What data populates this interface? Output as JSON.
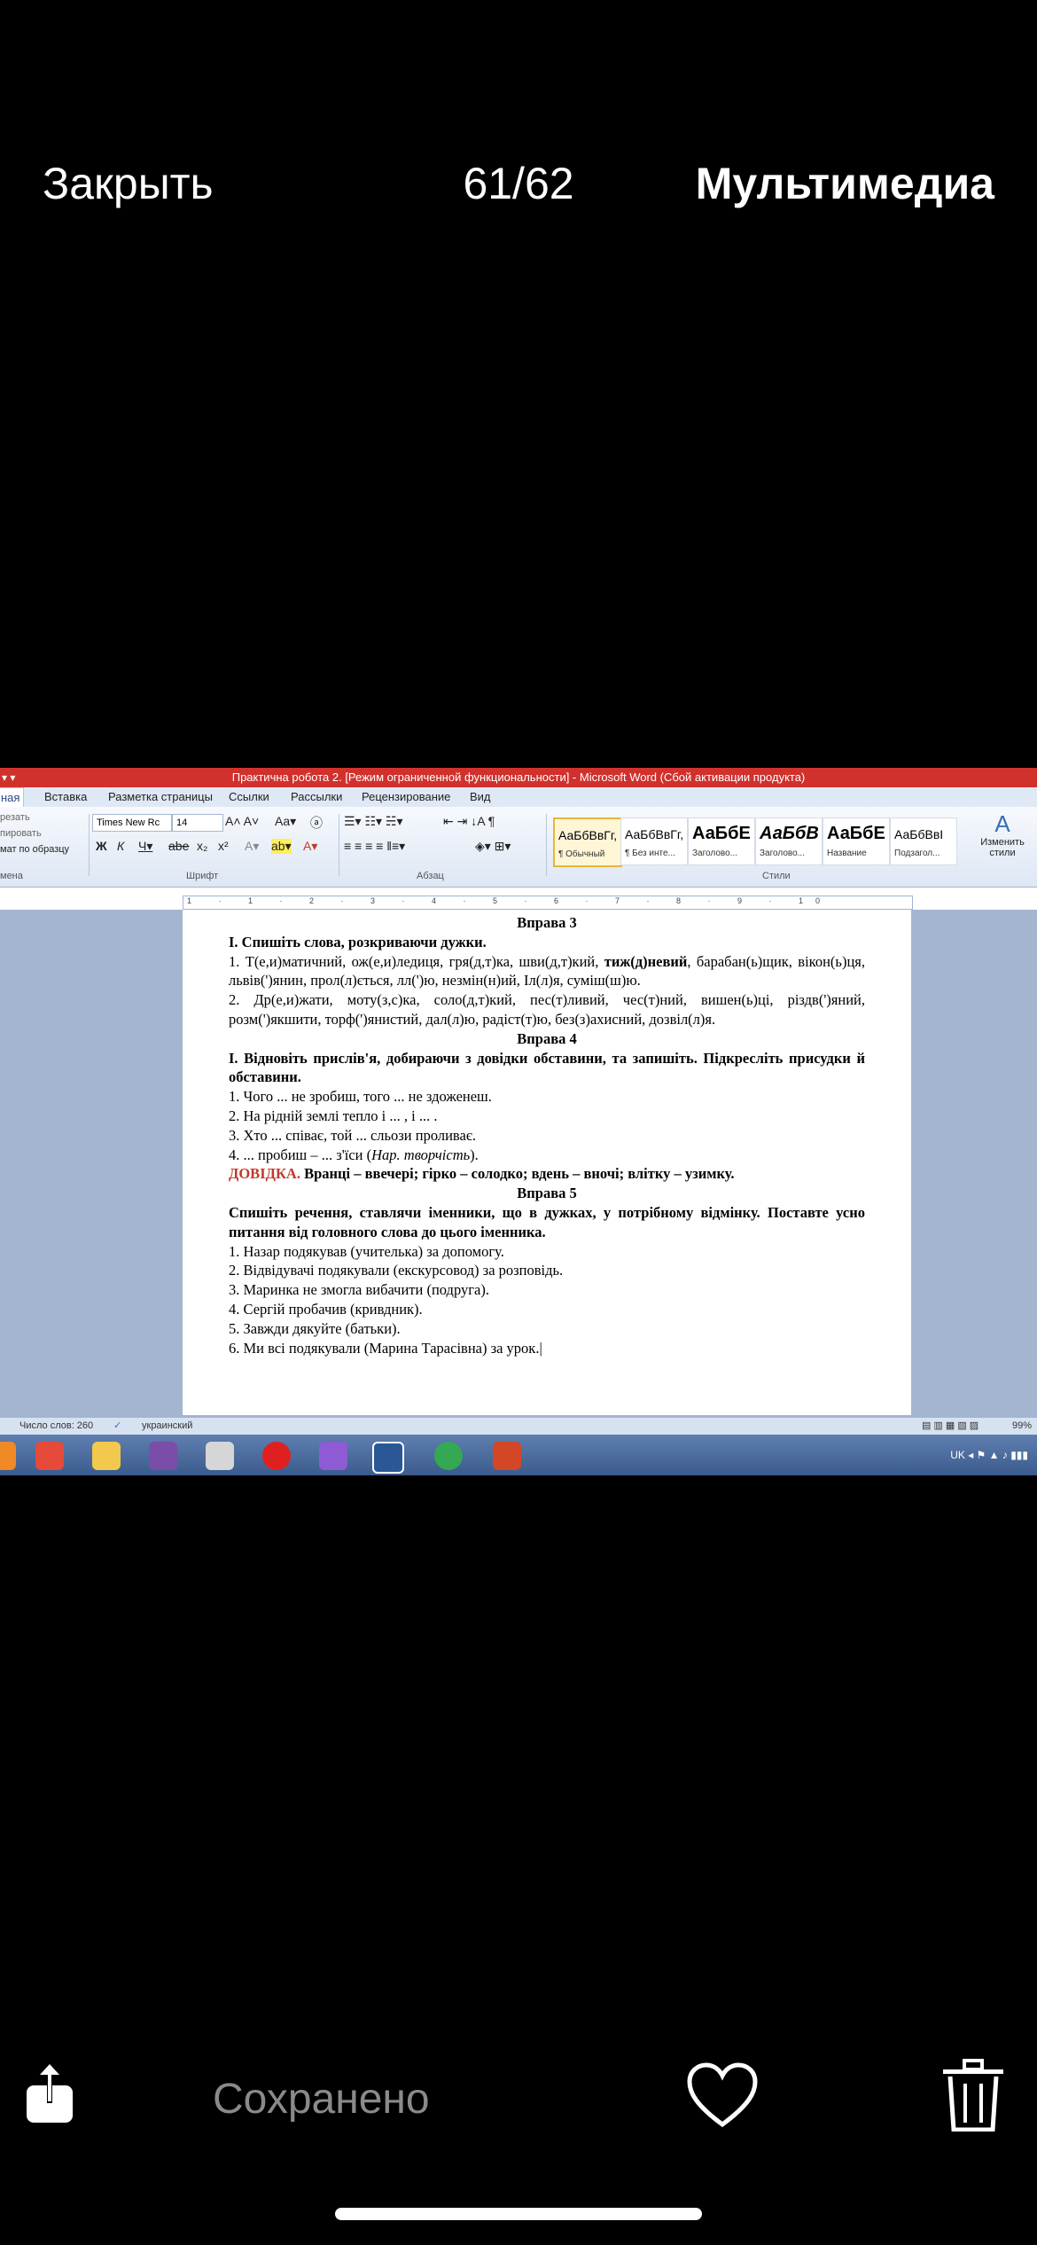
{
  "viewer": {
    "close_label": "Закрыть",
    "counter": "61/62",
    "media_label": "Мультимедиа",
    "saved_label": "Сохранено",
    "share_icon": "share-icon",
    "heart_icon": "heart-icon",
    "trash_icon": "trash-icon"
  },
  "word": {
    "title": "Практична робота 2. [Режим ограниченной функциональности] - Microsoft Word (Сбой активации продукта)",
    "tabs": [
      "ная",
      "Вставка",
      "Разметка страницы",
      "Ссылки",
      "Рассылки",
      "Рецензирование",
      "Вид"
    ],
    "clipboard": {
      "cut": "резать",
      "copy": "пировать",
      "format": "мат по образцу",
      "label": "мена"
    },
    "font": {
      "name": "Times New Rc",
      "size": "14",
      "label": "Шрифт"
    },
    "paragraph_label": "Абзац",
    "styles_label": "Стили",
    "styles": [
      {
        "sample": "АаБбВвГг,",
        "name": "¶ Обычный"
      },
      {
        "sample": "АаБбВвГг,",
        "name": "¶ Без инте..."
      },
      {
        "sample": "АаБбЕ",
        "name": "Заголово..."
      },
      {
        "sample": "АаБбВ",
        "name": "Заголово..."
      },
      {
        "sample": "АаБбЕ",
        "name": "Название"
      },
      {
        "sample": "АаБбВвI",
        "name": "Подзагол..."
      }
    ],
    "change_styles": "Изменить стили",
    "status": {
      "words": "Число слов: 260",
      "lang": "украинский",
      "zoom": "99%"
    },
    "tray_lang": "UK"
  },
  "document": {
    "v3_title": "Вправа 3",
    "v3_task": "I. Спишіть слова, розкриваючи дужки.",
    "v3_p1_a": "1. Т(е,и)матичний, ож(е,и)ледиця, гря(д,т)ка, шви(д,т)кий, ",
    "v3_p1_bold": "тиж(д)невий",
    "v3_p1_b": ", барабан(ь)щик, вікон(ь)ця, львів(')янин, прол(л)ється, лл(')ю, незмін(н)ий, Іл(л)я, суміш(ш)ю.",
    "v3_p2": "2. Др(е,и)жати, моту(з,с)ка, соло(д,т)кий, пес(т)ливий, чес(т)ний, вишен(ь)ці, різдв(')яний, розм(')якшити, торф(')янистий, дал(л)ю, радіст(т)ю, без(з)ахисний, дозвіл(л)я.",
    "v4_title": "Вправа 4",
    "v4_task": "I. Відновіть прислів'я, добираючи з довідки обставини, та запишіть. Підкресліть присудки й обставини.",
    "v4_items": [
      "1. Чого ... не зробиш, того ... не здоженеш.",
      "2. На рідній землі тепло і ... , і ... .",
      "3. Хто ... співає, той ... сльози проливає."
    ],
    "v4_item4_a": "4. ... пробиш – ... з'їси (",
    "v4_item4_italic": "Нар. творчість",
    "v4_item4_b": ").",
    "hint_label": "ДОВІДКА.",
    "hint_text": " Вранці – ввечері; гірко – солодко; вдень – вночі; влітку – узимку.",
    "v5_title": "Вправа 5",
    "v5_task": "Спишіть речення, ставлячи іменники, що в дужках, у потрібному відмінку. Поставте усно питання від головного слова до цього іменника.",
    "v5_items": [
      "1. Назар подякував (учителька) за допомогу.",
      "2. Відвідувачі подякували (екскурсовод) за розповідь.",
      "3. Маринка не змогла вибачити (подруга).",
      " 4. Сергій пробачив (кривдник).",
      "5. Завжди дякуйте (батьки).",
      "6. Ми всі подякували (Марина Тарасівна) за урок."
    ]
  }
}
